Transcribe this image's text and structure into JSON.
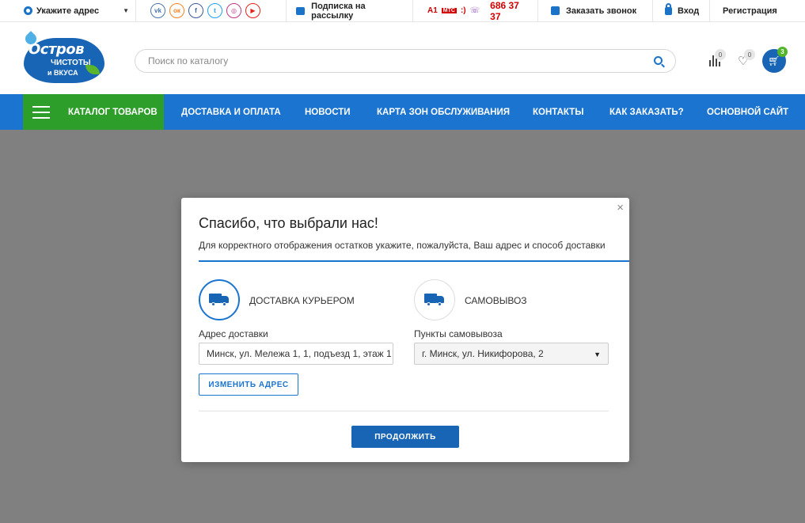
{
  "topbar": {
    "address_label": "Укажите адрес",
    "social": [
      {
        "icon": "vk-icon",
        "glyph": "vk",
        "color": "#4a76a8"
      },
      {
        "icon": "ok-icon",
        "glyph": "ок",
        "color": "#f58220"
      },
      {
        "icon": "facebook-icon",
        "glyph": "f",
        "color": "#3b5998"
      },
      {
        "icon": "twitter-icon",
        "glyph": "t",
        "color": "#1da1f2"
      },
      {
        "icon": "instagram-icon",
        "glyph": "◎",
        "color": "#c13584"
      },
      {
        "icon": "youtube-icon",
        "glyph": "▶",
        "color": "#e62117"
      }
    ],
    "subscribe_label": "Подписка на рассылку",
    "operators": [
      "A1",
      "МТС",
      ":)",
      "viber"
    ],
    "phone": "686 37 37",
    "callback_label": "Заказать звонок",
    "login_label": "Вход",
    "register_label": "Регистрация"
  },
  "header": {
    "logo": {
      "line1": "Остров",
      "line2": "ЧИСТОТЫ",
      "line3": "и ВКУСА"
    },
    "search_placeholder": "Поиск по каталогу",
    "compare_count": "0",
    "favorites_count": "0",
    "cart_count": "3"
  },
  "nav": {
    "catalog_label": "КАТАЛОГ ТОВАРОВ",
    "items": [
      "ДОСТАВКА И ОПЛАТА",
      "НОВОСТИ",
      "КАРТА ЗОН ОБСЛУЖИВАНИЯ",
      "КОНТАКТЫ",
      "КАК ЗАКАЗАТЬ?",
      "ОСНОВНОЙ САЙТ"
    ]
  },
  "modal": {
    "title": "Спасибо, что выбрали нас!",
    "subtitle": "Для корректного отображения остатков укажите, пожалуйста, Ваш адрес и способ доставки",
    "courier_label": "ДОСТАВКА КУРЬЕРОМ",
    "pickup_label": "САМОВЫВОЗ",
    "address_field_label": "Адрес доставки",
    "address_value": "Минск, ул. Мележа 1, 1, подъезд 1, этаж 1",
    "pickup_field_label": "Пункты самовывоза",
    "pickup_value": "г. Минск, ул. Никифорова, 2",
    "change_button": "ИЗМЕНИТЬ АДРЕС",
    "continue_button": "ПРОДОЛЖИТЬ",
    "close_glyph": "×"
  },
  "colors": {
    "brand_blue": "#1a74d0",
    "catalog_green": "#2e9e2a",
    "phone_red": "#d40000",
    "overlay": "#808080"
  }
}
